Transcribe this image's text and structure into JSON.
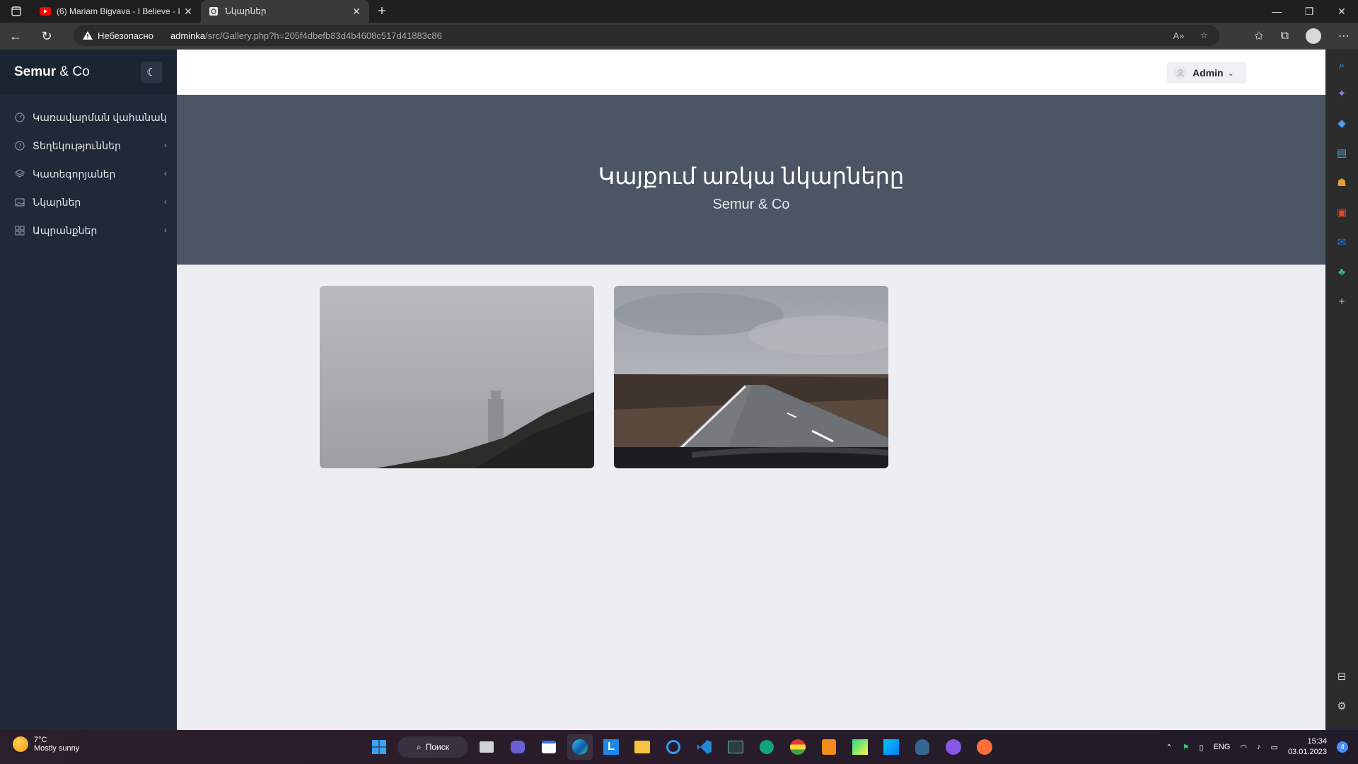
{
  "browser": {
    "tabs": [
      {
        "label": "(6) Mariam Bigvava - I Believe - I",
        "icon": "youtube-icon",
        "active": false
      },
      {
        "label": "Նկարներ",
        "icon": "page-icon",
        "active": true
      }
    ],
    "address": {
      "security_label": "Небезопасно",
      "host": "adminka",
      "path": "/src/Gallery.php?h=205f4dbefb83d4b4608c517d41883c86"
    }
  },
  "sidebar": {
    "brand": "Semur",
    "brand_suffix": "& Co",
    "items": [
      {
        "label": "Կառավարման վահանակ",
        "icon": "dashboard-icon",
        "has_children": false
      },
      {
        "label": "Տեղեկություններ",
        "icon": "help-icon",
        "has_children": true
      },
      {
        "label": "Կատեգորյաներ",
        "icon": "layers-icon",
        "has_children": true
      },
      {
        "label": "Նկարներ",
        "icon": "image-icon",
        "has_children": true
      },
      {
        "label": "Ապրանքներ",
        "icon": "grid-icon",
        "has_children": true
      }
    ]
  },
  "topbar": {
    "user_label": "Admin"
  },
  "hero": {
    "title": "Կայքում առկա նկարները",
    "subtitle": "Semur & Co"
  },
  "gallery": {
    "photos": [
      {
        "name": "foggy-lighthouse-photo"
      },
      {
        "name": "road-landscape-photo"
      }
    ]
  },
  "taskbar": {
    "weather_temp": "7°C",
    "weather_desc": "Mostly sunny",
    "search_label": "Поиск",
    "lang": "ENG",
    "time": "15:34",
    "date": "03.01.2023",
    "notifications": "4"
  },
  "colors": {
    "sidebar_bg": "#1f2937",
    "hero_bg": "#4b5563",
    "page_bg": "#eceef1"
  }
}
